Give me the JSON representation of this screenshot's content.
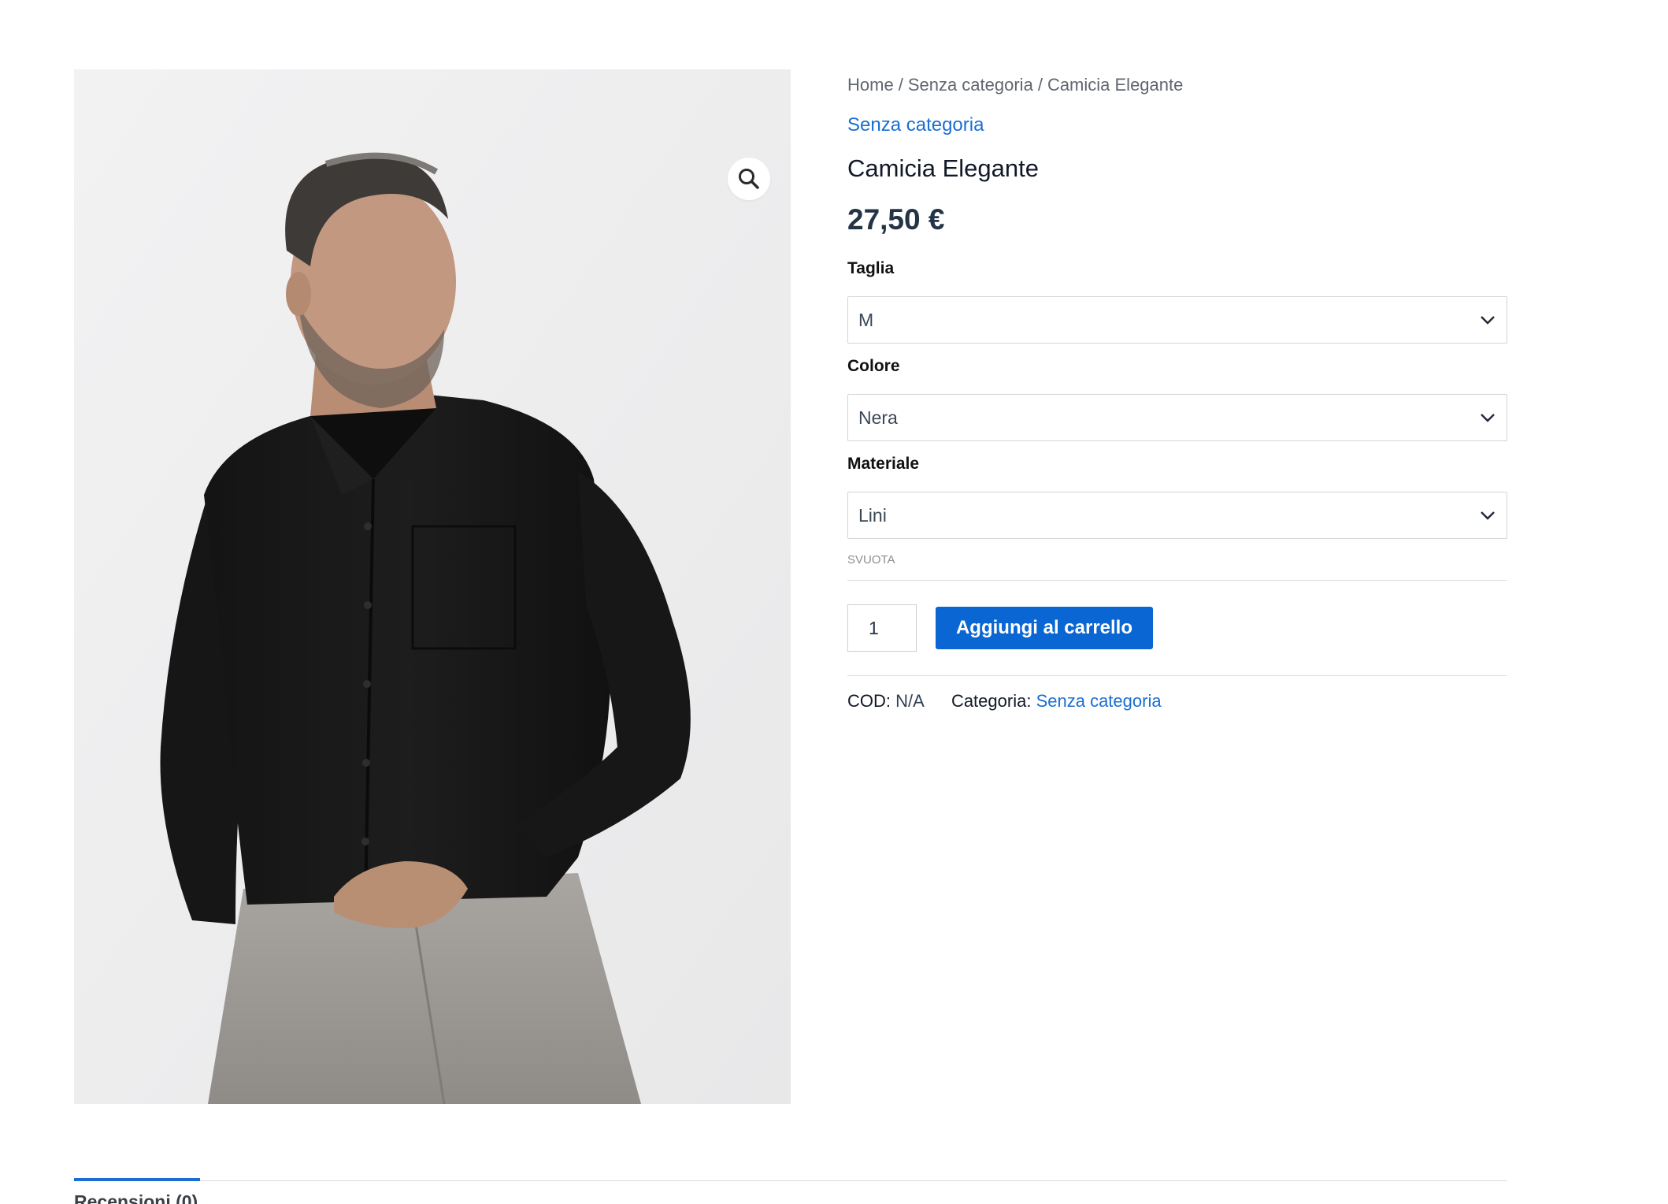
{
  "gallery": {
    "zoom_icon": "magnifier-icon",
    "image_alt": "Man wearing a black long-sleeve dress shirt and grey trousers"
  },
  "breadcrumb": {
    "home": "Home",
    "category": "Senza categoria",
    "current": "Camicia Elegante",
    "separator": "/"
  },
  "product": {
    "category_link": "Senza categoria",
    "title": "Camicia Elegante",
    "price": "27,50 €"
  },
  "variations": [
    {
      "label": "Taglia",
      "value": "M"
    },
    {
      "label": "Colore",
      "value": "Nera"
    },
    {
      "label": "Materiale",
      "value": "Lini"
    }
  ],
  "reset_label": "Svuota",
  "cart": {
    "quantity": "1",
    "add_to_cart_label": "Aggiungi al carrello"
  },
  "meta": {
    "sku_label": "COD:",
    "sku_value": "N/A",
    "category_label": "Categoria:",
    "category_value": "Senza categoria"
  },
  "tabs": [
    {
      "label": "Recensioni (0)",
      "active": true
    }
  ],
  "colors": {
    "accent": "#1a6ed2",
    "button": "#0a66d3",
    "text_dark": "#111827",
    "text_muted": "#5f6670",
    "border": "#d0d4d9"
  }
}
